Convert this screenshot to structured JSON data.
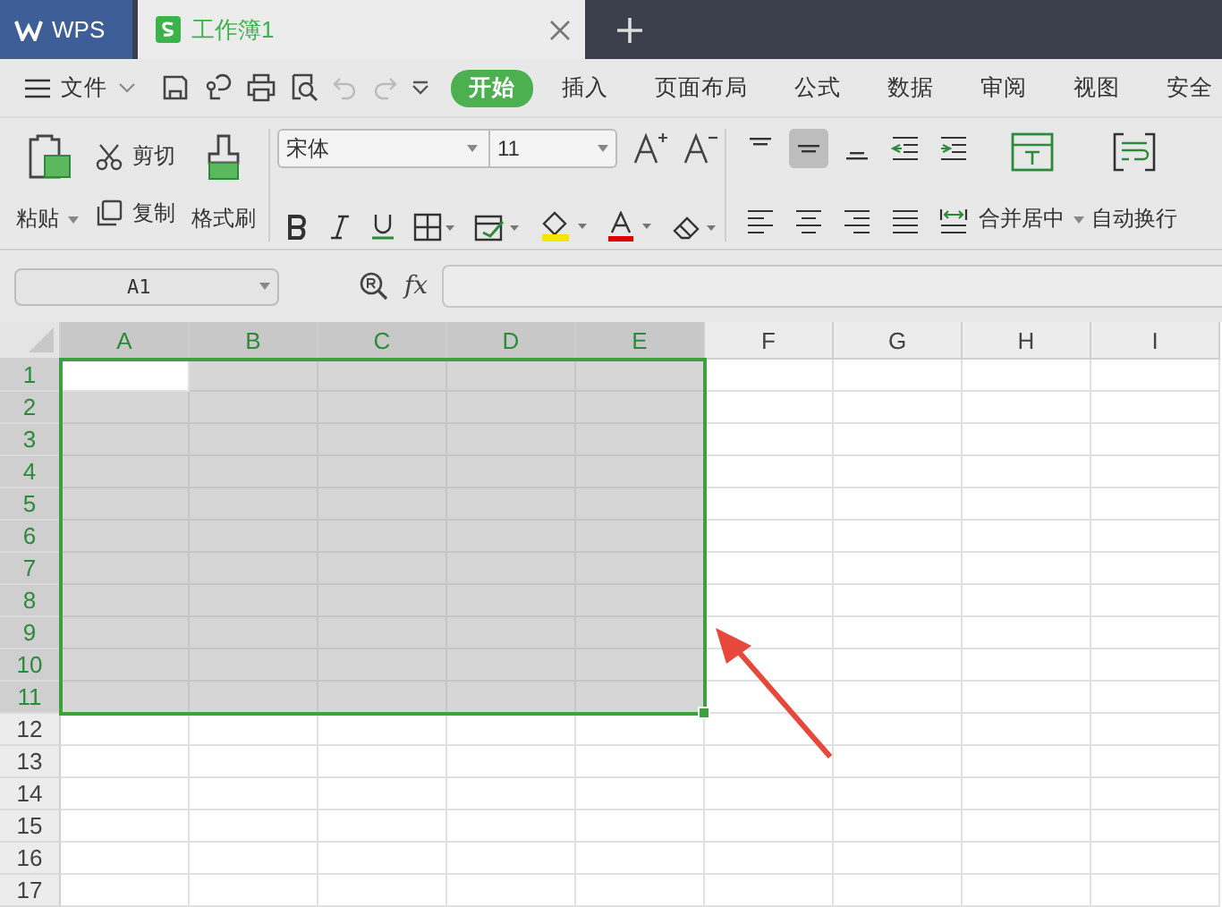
{
  "app_tab": {
    "label": "WPS"
  },
  "document_tabs": [
    {
      "label": "工作簿1",
      "selected": true
    }
  ],
  "menu": {
    "file": "文件",
    "tabs": [
      {
        "label": "开始",
        "selected": true
      },
      {
        "label": "插入",
        "selected": false
      },
      {
        "label": "页面布局",
        "selected": false
      },
      {
        "label": "公式",
        "selected": false
      },
      {
        "label": "数据",
        "selected": false
      },
      {
        "label": "审阅",
        "selected": false
      },
      {
        "label": "视图",
        "selected": false
      },
      {
        "label": "安全",
        "selected": false
      }
    ]
  },
  "ribbon": {
    "paste": "粘贴",
    "cut": "剪切",
    "copy": "复制",
    "format_painter": "格式刷",
    "font_name": "宋体",
    "font_size": "11",
    "vertical_align": [
      {
        "kind": "top",
        "selected": false
      },
      {
        "kind": "middle",
        "selected": true
      },
      {
        "kind": "bottom",
        "selected": false
      }
    ],
    "merge": "合并居中",
    "wrap": "自动换行"
  },
  "formula_bar": {
    "name_box": "A1",
    "fx": "fx"
  },
  "sheet": {
    "columns": [
      {
        "label": "A",
        "selected": true
      },
      {
        "label": "B",
        "selected": true
      },
      {
        "label": "C",
        "selected": true
      },
      {
        "label": "D",
        "selected": true
      },
      {
        "label": "E",
        "selected": true
      },
      {
        "label": "F",
        "selected": false
      },
      {
        "label": "G",
        "selected": false
      },
      {
        "label": "H",
        "selected": false
      },
      {
        "label": "I",
        "selected": false
      }
    ],
    "rows": [
      {
        "label": "1",
        "selected": true
      },
      {
        "label": "2",
        "selected": true
      },
      {
        "label": "3",
        "selected": true
      },
      {
        "label": "4",
        "selected": true
      },
      {
        "label": "5",
        "selected": true
      },
      {
        "label": "6",
        "selected": true
      },
      {
        "label": "7",
        "selected": true
      },
      {
        "label": "8",
        "selected": true
      },
      {
        "label": "9",
        "selected": true
      },
      {
        "label": "10",
        "selected": true
      },
      {
        "label": "11",
        "selected": true
      },
      {
        "label": "12",
        "selected": false
      },
      {
        "label": "13",
        "selected": false
      },
      {
        "label": "14",
        "selected": false
      },
      {
        "label": "15",
        "selected": false
      },
      {
        "label": "16",
        "selected": false
      },
      {
        "label": "17",
        "selected": false
      }
    ]
  }
}
